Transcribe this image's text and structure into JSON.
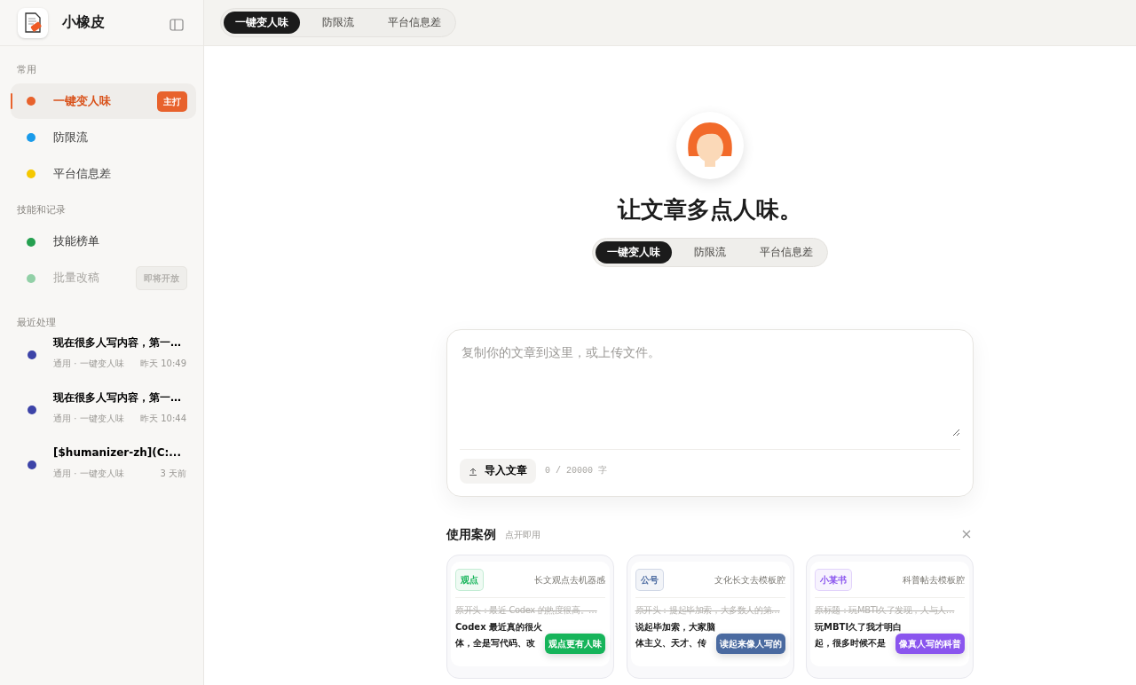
{
  "brand": {
    "name": "小橡皮"
  },
  "top_tabs": [
    {
      "label": "一键变人味",
      "selected": true
    },
    {
      "label": "防限流",
      "selected": false
    },
    {
      "label": "平台信息差",
      "selected": false
    }
  ],
  "sidebar": {
    "sections": [
      {
        "title": "常用",
        "items": [
          {
            "label": "一键变人味",
            "color": "#e8622c",
            "selected": true,
            "disabled": false,
            "badge": "主打"
          },
          {
            "label": "防限流",
            "color": "#1a9bea",
            "selected": false,
            "disabled": false
          },
          {
            "label": "平台信息差",
            "color": "#f5c800",
            "selected": false,
            "disabled": false
          }
        ]
      },
      {
        "title": "技能和记录",
        "items": [
          {
            "label": "技能榜单",
            "color": "#25a050",
            "selected": false,
            "disabled": false
          },
          {
            "label": "批量改稿",
            "color": "#92d0a7",
            "selected": false,
            "disabled": true,
            "badge": "即将开放"
          }
        ]
      }
    ],
    "recent_title": "最近处理",
    "recent": [
      {
        "title": "现在很多人写内容，第一…",
        "meta": "通用 · 一键变人味",
        "time": "昨天 10:49"
      },
      {
        "title": "现在很多人写内容，第一…",
        "meta": "通用 · 一键变人味",
        "time": "昨天 10:44"
      },
      {
        "title": "[$humanizer-zh](C:...",
        "meta": "通用 · 一键变人味",
        "time": "3 天前"
      }
    ]
  },
  "hero": {
    "title": "让文章多点人味。",
    "tabs": [
      {
        "label": "一键变人味",
        "selected": true
      },
      {
        "label": "防限流",
        "selected": false
      },
      {
        "label": "平台信息差",
        "selected": false
      }
    ]
  },
  "editor": {
    "placeholder": "复制你的文章到这里，或上传文件。",
    "import_button": "导入文章",
    "counter": "0 / 20000 字"
  },
  "cases": {
    "title": "使用案例",
    "hint": "点开即用",
    "items": [
      {
        "tag": "观点",
        "color": "#16b45a",
        "subtitle": "长文观点去机器感",
        "original": "原开头：最近 Codex 的热度很高。…",
        "lines": [
          "Codex 最近真的很火",
          "体，全是写代码、改"
        ],
        "result": "观点更有人味"
      },
      {
        "tag": "公号",
        "color": "#4a6aa0",
        "subtitle": "文化长文去模板腔",
        "original": "原开头：提起毕加索，大多数人的第…",
        "lines": [
          "说起毕加索，大家脑",
          "体主义、天才、传"
        ],
        "result": "读起来像人写的"
      },
      {
        "tag": "小某书",
        "color": "#8a55ee",
        "subtitle": "科普帖去模板腔",
        "original": "原标题：玩MBTI久了发现，人与人…",
        "lines": [
          "玩MBTI久了我才明白",
          "起，很多时候不是"
        ],
        "result": "像真人写的科普"
      }
    ]
  }
}
